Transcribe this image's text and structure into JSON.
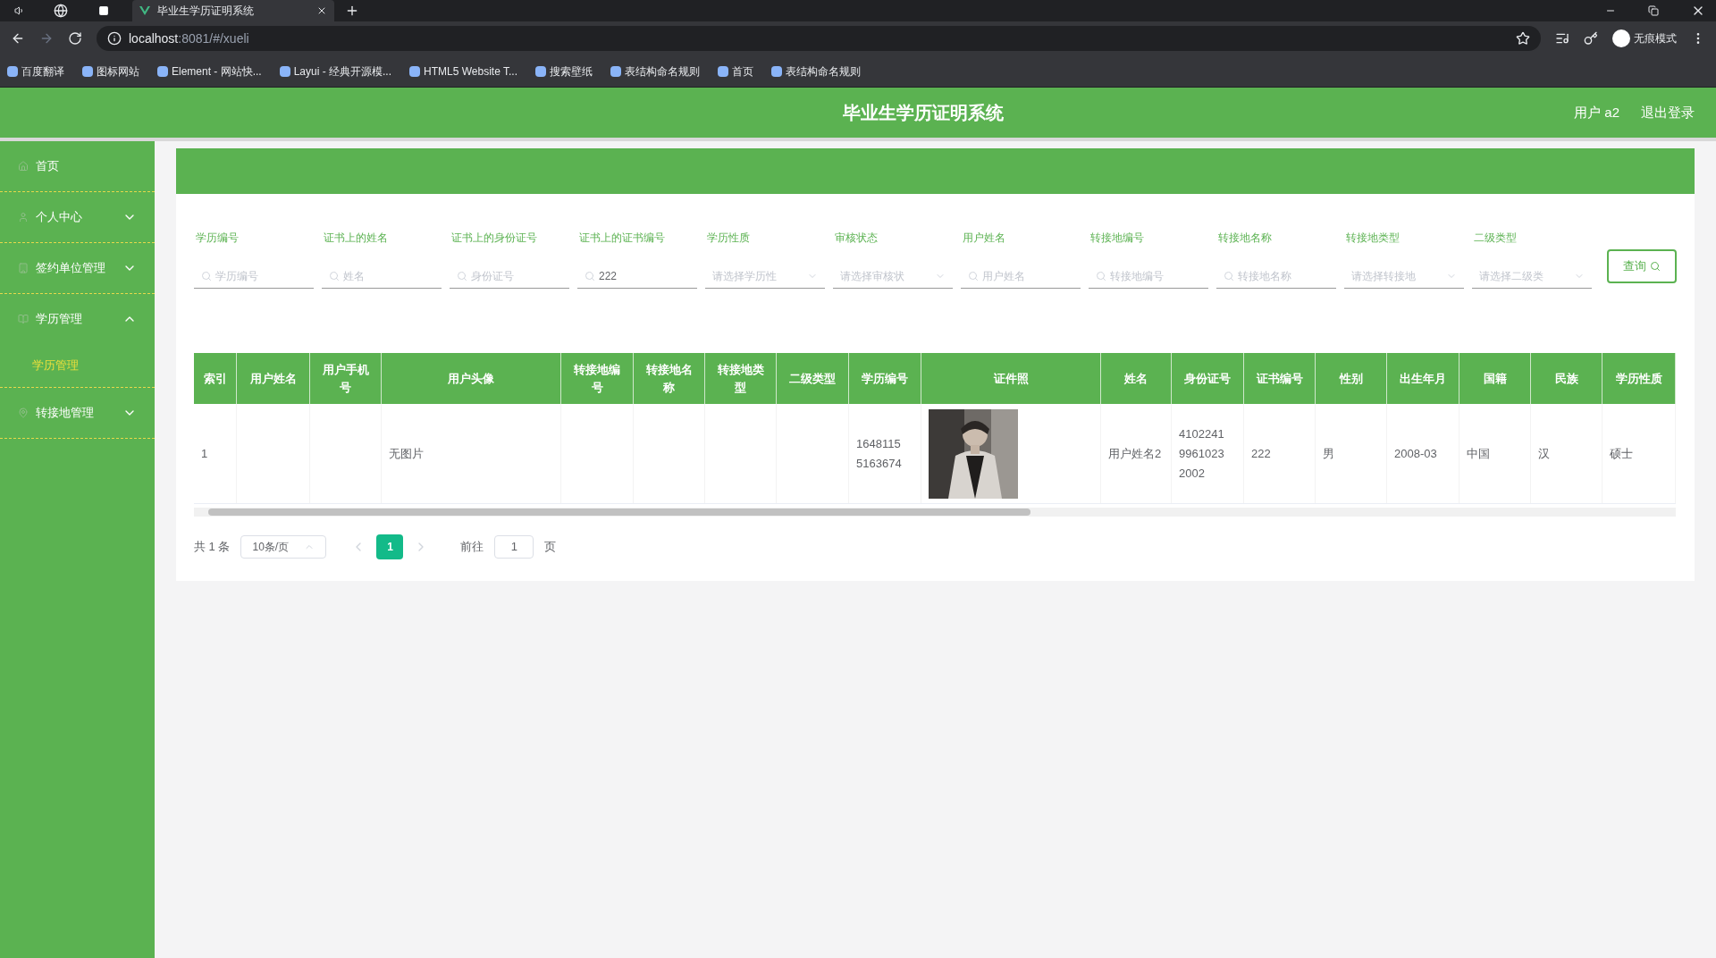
{
  "browser": {
    "tab_title": "毕业生学历证明系统",
    "url_host": "localhost",
    "url_rest": ":8081/#/xueli",
    "bookmarks": [
      "百度翻译",
      "图标网站",
      "Element - 网站快...",
      "Layui - 经典开源模...",
      "HTML5 Website T...",
      "搜索壁纸",
      "表结构命名规则",
      "首页",
      "表结构命名规则"
    ],
    "incognito_label": "无痕模式"
  },
  "header": {
    "title": "毕业生学历证明系统",
    "user": "用户 a2",
    "logout": "退出登录"
  },
  "sidebar": {
    "items": [
      {
        "label": "首页",
        "expandable": false
      },
      {
        "label": "个人中心",
        "expandable": true,
        "expanded": false
      },
      {
        "label": "签约单位管理",
        "expandable": true,
        "expanded": false
      },
      {
        "label": "学历管理",
        "expandable": true,
        "expanded": true,
        "children": [
          {
            "label": "学历管理",
            "selected": true
          }
        ]
      },
      {
        "label": "转接地管理",
        "expandable": true,
        "expanded": false
      }
    ]
  },
  "filters": [
    {
      "label": "学历编号",
      "kind": "input",
      "placeholder": "学历编号"
    },
    {
      "label": "证书上的姓名",
      "kind": "input",
      "placeholder": "姓名"
    },
    {
      "label": "证书上的身份证号",
      "kind": "input",
      "placeholder": "身份证号"
    },
    {
      "label": "证书上的证书编号",
      "kind": "input",
      "value": "222"
    },
    {
      "label": "学历性质",
      "kind": "select",
      "placeholder": "请选择学历性"
    },
    {
      "label": "审核状态",
      "kind": "select",
      "placeholder": "请选择审核状"
    },
    {
      "label": "用户姓名",
      "kind": "input",
      "placeholder": "用户姓名"
    },
    {
      "label": "转接地编号",
      "kind": "input",
      "placeholder": "转接地编号"
    },
    {
      "label": "转接地名称",
      "kind": "input",
      "placeholder": "转接地名称"
    },
    {
      "label": "转接地类型",
      "kind": "select",
      "placeholder": "请选择转接地"
    },
    {
      "label": "二级类型",
      "kind": "select",
      "placeholder": "请选择二级类"
    }
  ],
  "search_button": "查询",
  "table": {
    "columns": [
      "索引",
      "用户姓名",
      "用户手机号",
      "用户头像",
      "转接地编号",
      "转接地名称",
      "转接地类型",
      "二级类型",
      "学历编号",
      "证件照",
      "姓名",
      "身份证号",
      "证书编号",
      "性别",
      "出生年月",
      "国籍",
      "民族",
      "学历性质"
    ],
    "rows": [
      {
        "cells": [
          {
            "kind": "text",
            "text": "1"
          },
          {
            "kind": "empty"
          },
          {
            "kind": "empty"
          },
          {
            "kind": "text",
            "text": "无图片"
          },
          {
            "kind": "empty"
          },
          {
            "kind": "empty"
          },
          {
            "kind": "empty"
          },
          {
            "kind": "empty"
          },
          {
            "kind": "text",
            "text": "1648115 5163674"
          },
          {
            "kind": "picture"
          },
          {
            "kind": "text",
            "text": "用户姓名2"
          },
          {
            "kind": "text",
            "text": "4102241 9961023 2002"
          },
          {
            "kind": "text",
            "text": "222"
          },
          {
            "kind": "text",
            "text": "男"
          },
          {
            "kind": "text",
            "text": "2008-03"
          },
          {
            "kind": "text",
            "text": "中国"
          },
          {
            "kind": "text",
            "text": "汉"
          },
          {
            "kind": "text",
            "text": "硕士"
          }
        ]
      }
    ]
  },
  "pagination": {
    "total": "共 1 条",
    "page_size": "10条/页",
    "pages": [
      {
        "label": "1",
        "selected": true
      }
    ],
    "goto_label": "前往",
    "goto_value": "1",
    "goto_suffix": "页"
  }
}
